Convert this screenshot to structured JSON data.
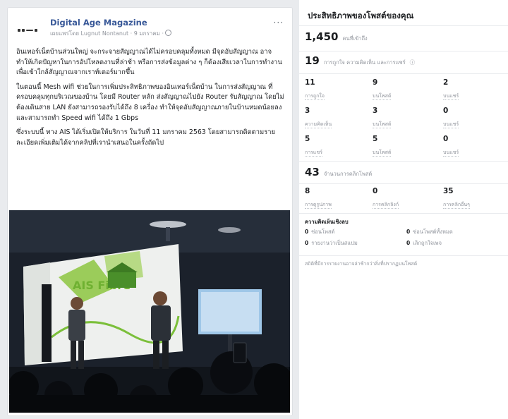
{
  "post": {
    "page_name": "Digital Age Magazine",
    "meta": "เผยแพร่โดย Lugnut Nontanut · 9 มกราคม ·",
    "more": "···",
    "paragraphs": [
      "อินเทอร์เน็ตบ้านส่วนใหญ่ จะกระจายสัญญาณได้ไม่ครอบคลุมทั้งหมด มีจุดอับสัญญาณ อาจทำให้เกิดปัญหาในการอัปโหลดงานที่ล่าช้า หรือการส่งข้อมูลต่าง ๆ ก็ต้องเสียเวลาในการทำงานเพื่อเข้าใกล้สัญญาณจากเราท์เตอร์มากขึ้น",
      "ในตอนนี้ Mesh wifi ช่วยในการเพิ่มประสิทธิภาพของอินเทอร์เน็ตบ้าน ในการส่งสัญญาณ ที่ครอบคลุมทุกบริเวณของบ้าน โดยมี Router หลัก ส่งสัญญาณไปยัง Router รับสัญญาณ โดยไม่ต้องเดินสาย LAN ยังสามารถรองรับได้ถึง 8 เครื่อง ทำให้จุดอับสัญญาณภายในบ้านหมดน้อยลง และสามารถทำ Speed wifi ได้ถึง 1 Gbps",
      "ซึ่งระบบนี้ ทาง AIS ได้เริ่มเปิดให้บริการ ในวันที่ 11 มกราคม 2563 โดยสามารถติดตามรายละเอียดเพิ่มเติมได้จากคลิปที่เรานำเสนอในครั้งถัดไป"
    ],
    "photo_sign": "AIS Fibre"
  },
  "insights": {
    "title": "ประสิทธิภาพของโพสต์ของคุณ",
    "reach": {
      "value": "1,450",
      "label": "คนที่เข้าถึง"
    },
    "engagement": {
      "value": "19",
      "label": "การถูกใจ ความคิดเห็น และการแชร์"
    },
    "stats": [
      {
        "value": "11",
        "label": "การถูกใจ"
      },
      {
        "value": "9",
        "label": "บนโพสต์"
      },
      {
        "value": "2",
        "label": "บนแชร์"
      },
      {
        "value": "3",
        "label": "ความคิดเห็น"
      },
      {
        "value": "3",
        "label": "บนโพสต์"
      },
      {
        "value": "0",
        "label": "บนแชร์"
      },
      {
        "value": "5",
        "label": "การแชร์"
      },
      {
        "value": "5",
        "label": "บนโพสต์"
      },
      {
        "value": "0",
        "label": "บนแชร์"
      }
    ],
    "clicks": {
      "value": "43",
      "label": "จำนวนการคลิกโพสต์"
    },
    "click_stats": [
      {
        "value": "8",
        "label": "การดูรูปภาพ"
      },
      {
        "value": "0",
        "label": "การคลิกลิงก์"
      },
      {
        "value": "35",
        "label": "การคลิกอื่นๆ"
      }
    ],
    "negative": {
      "title": "ความคิดเห็นเชิงลบ",
      "items": [
        {
          "value": "0",
          "label": "ซ่อนโพสต์"
        },
        {
          "value": "0",
          "label": "ซ่อนโพสต์ทั้งหมด"
        },
        {
          "value": "0",
          "label": "รายงานว่าเป็นสแปม"
        },
        {
          "value": "0",
          "label": "เลิกถูกใจเพจ"
        }
      ]
    },
    "note": "สถิติที่มีการรายงานอาจล่าช้ากว่าสิ่งที่ปรากฏบนโพสต์"
  }
}
